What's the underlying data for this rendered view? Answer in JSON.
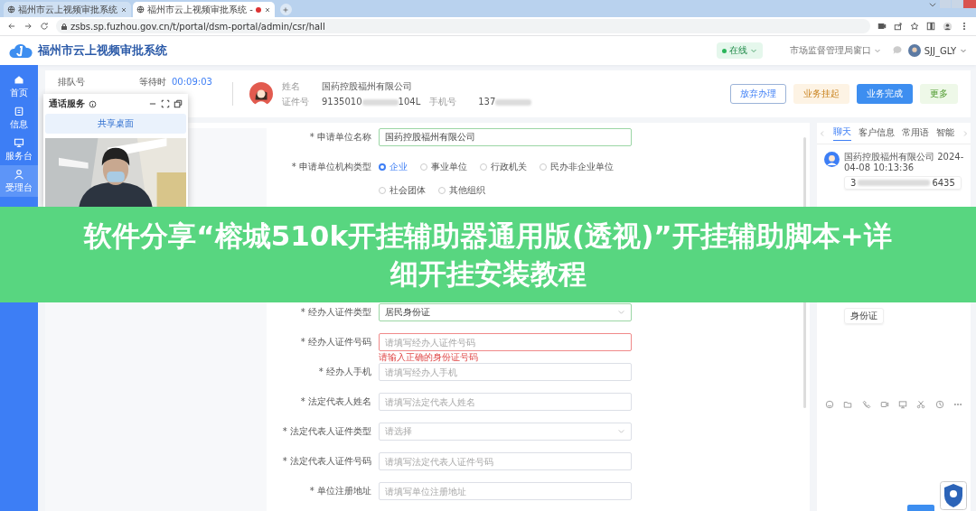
{
  "browser": {
    "tabs": [
      {
        "title": "福州市云上视频审批系统",
        "selected": false
      },
      {
        "title": "福州市云上视频审批系统 - ",
        "selected": true
      }
    ],
    "url": "zsbs.sp.fuzhou.gov.cn/t/portal/dsm-portal/admin/csr/hall"
  },
  "app": {
    "title": "福州市云上视频审批系统",
    "status": "在线",
    "window": "市场监督管理局窗口",
    "user": "SJJ_GLY"
  },
  "nav": [
    {
      "label": "首页",
      "selected": false
    },
    {
      "label": "信息",
      "selected": false
    },
    {
      "label": "服务台",
      "selected": false
    },
    {
      "label": "受理台",
      "selected": true
    }
  ],
  "queue": {
    "label": "排队号",
    "wait_label": "等待时",
    "wait_time": "00:09:03"
  },
  "customer": {
    "name_label": "姓名",
    "name": "国药控股福州有限公司",
    "id_label": "证件号",
    "id_start": "9135010",
    "id_end": "104L",
    "phone_label": "手机号",
    "phone_start": "137"
  },
  "actions": [
    {
      "label": "放弃办理",
      "kind": "outline"
    },
    {
      "label": "业务挂起",
      "kind": "warning"
    },
    {
      "label": "业务完成",
      "kind": "primary"
    },
    {
      "label": "更多",
      "kind": "success"
    }
  ],
  "call_panel": {
    "title": "通话服务",
    "share_button": "共享桌面"
  },
  "form": {
    "rows_above": [
      {
        "label": "* 申请单位名称",
        "kind": "text",
        "value": "国药控股福州有限公司"
      },
      {
        "label": "* 申请单位机构类型",
        "kind": "radio",
        "options": [
          {
            "label": "企业",
            "selected": true
          },
          {
            "label": "事业单位",
            "selected": false
          },
          {
            "label": "行政机关",
            "selected": false
          },
          {
            "label": "民办非企业单位",
            "selected": false
          },
          {
            "label": "社会团体",
            "selected": false
          },
          {
            "label": "其他组织",
            "selected": false
          }
        ]
      }
    ],
    "rows_below": [
      {
        "label": "* 经办人证件类型",
        "kind": "select",
        "value": "居民身份证"
      },
      {
        "label": "* 经办人证件号码",
        "kind": "input",
        "placeholder": "请填写经办人证件号码",
        "error": "请输入正确的身份证号码"
      },
      {
        "label": "* 经办人手机",
        "kind": "input",
        "placeholder": "请填写经办人手机"
      },
      {
        "label": "* 法定代表人姓名",
        "kind": "input",
        "placeholder": "请填写法定代表人姓名"
      },
      {
        "label": "* 法定代表人证件类型",
        "kind": "select",
        "placeholder": "请选择"
      },
      {
        "label": "* 法定代表人证件号码",
        "kind": "input",
        "placeholder": "请填写法定代表人证件号码"
      },
      {
        "label": "* 单位注册地址",
        "kind": "input",
        "placeholder": "请填写单位注册地址"
      }
    ]
  },
  "chat": {
    "tabs": [
      {
        "label": "聊天",
        "selected": true
      },
      {
        "label": "客户信息",
        "selected": false
      },
      {
        "label": "常用语",
        "selected": false
      },
      {
        "label": "智能",
        "selected": false
      }
    ],
    "messages_above": [
      {
        "sender": "国药控股福州有限公司 2024-04-08 10:13:36",
        "text_start": "3",
        "text_end": "6435"
      }
    ],
    "messages_below": [
      {
        "text_start": "身份证"
      }
    ]
  },
  "banner": [
    "软件分享“榕城510k开挂辅助器通用版(透视)”开挂辅助脚本+详",
    "细开挂安装教程"
  ]
}
